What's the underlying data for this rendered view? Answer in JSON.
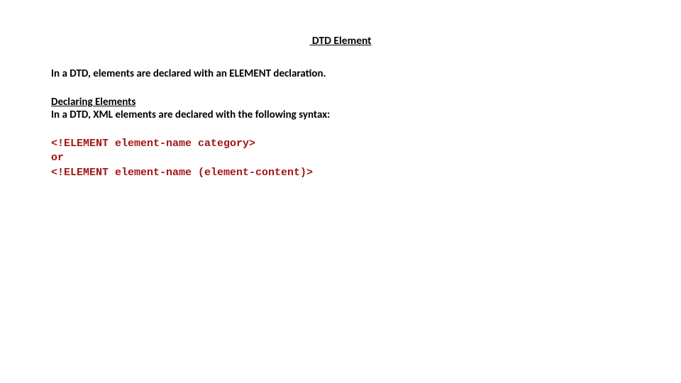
{
  "title": " DTD Element",
  "intro": "In a DTD, elements are declared with an ELEMENT declaration.",
  "section_heading": "Declaring Elements",
  "section_line": "In a DTD, XML elements are declared with the following syntax:",
  "code": "<!ELEMENT element-name category>\nor\n<!ELEMENT element-name (element-content)>"
}
